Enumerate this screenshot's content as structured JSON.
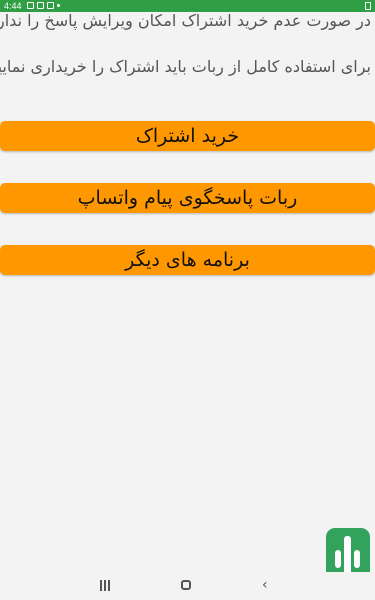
{
  "status_bar": {
    "time": "4:44",
    "icons": [
      "notification-icon",
      "image-icon",
      "briefcase-icon",
      "dot-icon",
      "battery-icon"
    ]
  },
  "info": {
    "line1": "در صورت عدم خرید اشتراک امکان ویرایش پاسخ را ندارید",
    "line2": "برای استفاده کامل از ربات باید اشتراک را خریداری نمایید"
  },
  "buttons": {
    "buy_subscription": "خرید اشتراک",
    "whatsapp_bot": "ربات پاسخگوی پیام واتساپ",
    "other_apps": "برنامه های دیگر"
  },
  "colors": {
    "status_bar": "#2f9e44",
    "button": "#ff9800",
    "background": "#f3f3f3"
  }
}
